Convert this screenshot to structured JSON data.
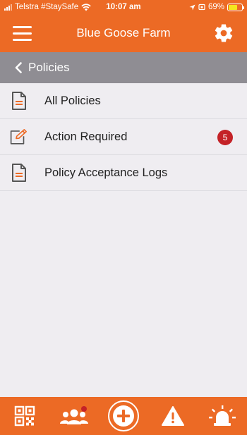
{
  "status_bar": {
    "carrier": "Telstra #StaySafe",
    "time": "10:07 am",
    "battery": "69%",
    "battery_level": 0.69
  },
  "header": {
    "title": "Blue Goose Farm",
    "menu_icon": "hamburger-icon",
    "settings_icon": "gear-icon"
  },
  "subheader": {
    "title": "Policies",
    "back_icon": "chevron-left-icon"
  },
  "menu": {
    "items": [
      {
        "label": "All Policies",
        "icon": "document-icon"
      },
      {
        "label": "Action Required",
        "icon": "edit-icon",
        "badge": "5"
      },
      {
        "label": "Policy Acceptance Logs",
        "icon": "document-icon"
      }
    ]
  },
  "tab_bar": {
    "items": [
      {
        "icon": "qr-code-icon"
      },
      {
        "icon": "users-icon"
      },
      {
        "icon": "add-circle-icon"
      },
      {
        "icon": "warning-icon"
      },
      {
        "icon": "alarm-light-icon"
      }
    ]
  },
  "colors": {
    "primary": "#ec6a25",
    "subheader": "#8f8d93",
    "background": "#efedf1",
    "badge": "#c42227"
  }
}
